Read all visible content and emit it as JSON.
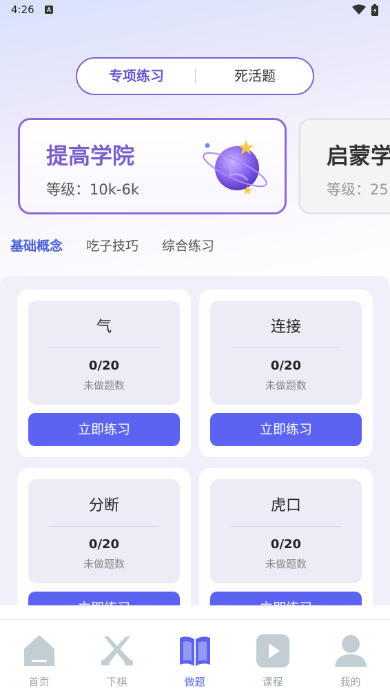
{
  "status_bar": {
    "time": "4:26",
    "a_icon_letter": "A"
  },
  "segment": {
    "active_label": "专项练习",
    "inactive_label": "死活题"
  },
  "level_cards": [
    {
      "title": "提高学院",
      "level_text": "等级：10k-6k",
      "state": "selected"
    },
    {
      "title": "启蒙学",
      "level_text": "等级：25",
      "state": "unselected"
    }
  ],
  "category_tabs": [
    {
      "label": "基础概念",
      "active": true
    },
    {
      "label": "吃子技巧",
      "active": false
    },
    {
      "label": "综合练习",
      "active": false
    }
  ],
  "questions": [
    {
      "name": "气",
      "count": "0/20",
      "count_label": "未做题数",
      "button": "立即练习"
    },
    {
      "name": "连接",
      "count": "0/20",
      "count_label": "未做题数",
      "button": "立即练习"
    },
    {
      "name": "分断",
      "count": "0/20",
      "count_label": "未做题数",
      "button": "立即练习"
    },
    {
      "name": "虎口",
      "count": "0/20",
      "count_label": "未做题数",
      "button": "立即练习"
    }
  ],
  "bottom_nav": [
    {
      "label": "首页",
      "icon": "home-icon",
      "active": false
    },
    {
      "label": "下棋",
      "icon": "swords-icon",
      "active": false
    },
    {
      "label": "做题",
      "icon": "book-icon",
      "active": true
    },
    {
      "label": "课程",
      "icon": "play-icon",
      "active": false
    },
    {
      "label": "我的",
      "icon": "user-icon",
      "active": false
    }
  ],
  "colors": {
    "accent": "#5c63f2",
    "purple": "#7a5ec9",
    "tab_active": "#4a62d8",
    "nav_inactive": "#9aa3ad"
  }
}
